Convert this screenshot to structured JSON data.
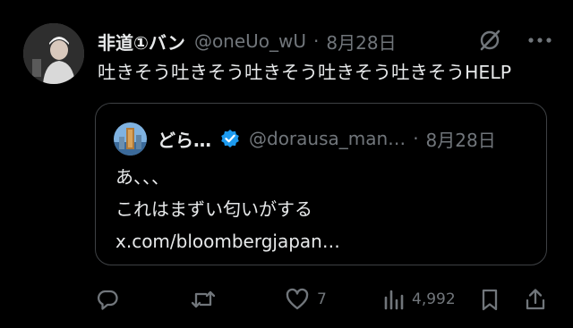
{
  "tweet": {
    "author_name": "非道①バン",
    "author_handle": "@oneUo_wU",
    "separator": "·",
    "date": "8月28日",
    "text": "吐きそう吐きそう吐きそう吐きそう吐きそうHELP"
  },
  "quote": {
    "author_name": "どら…",
    "author_handle": "@dorausa_man…",
    "separator": "·",
    "date": "8月28日",
    "lines": [
      "あ、、、",
      "これはまずい匂いがする",
      "x.com/bloombergjapan…"
    ]
  },
  "actions": {
    "reply_count": "",
    "retweet_count": "",
    "like_count": "7",
    "views_count": "4,992"
  },
  "icons": {
    "grok": "grok-icon",
    "more": "more-icon",
    "reply": "reply-icon",
    "retweet": "retweet-icon",
    "like": "heart-icon",
    "views": "views-icon",
    "bookmark": "bookmark-icon",
    "share": "share-icon",
    "verified": "verified-badge-icon"
  },
  "colors": {
    "background": "#000000",
    "text": "#e7e9ea",
    "muted": "#71767b",
    "verified": "#1d9bf0",
    "border": "#3e4144"
  }
}
